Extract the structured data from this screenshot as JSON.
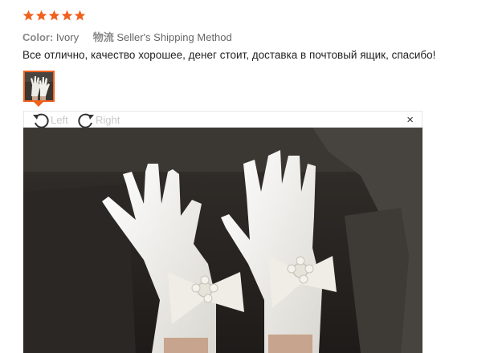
{
  "rating": {
    "value": 5,
    "max": 5,
    "color": "#f0611e",
    "icon": "star-icon"
  },
  "attributes": {
    "color_label": "Color:",
    "color_value": "Ivory",
    "shipping_label": "物流",
    "shipping_value": "Seller's Shipping Method"
  },
  "review_text": "Все отлично, качество хорошее, денег стоит, доставка в почтовый ящик, спасибо!",
  "viewer": {
    "rotate_left_label": "Left",
    "rotate_right_label": "Right",
    "close_label": "×",
    "accent_color": "#f0611e"
  }
}
